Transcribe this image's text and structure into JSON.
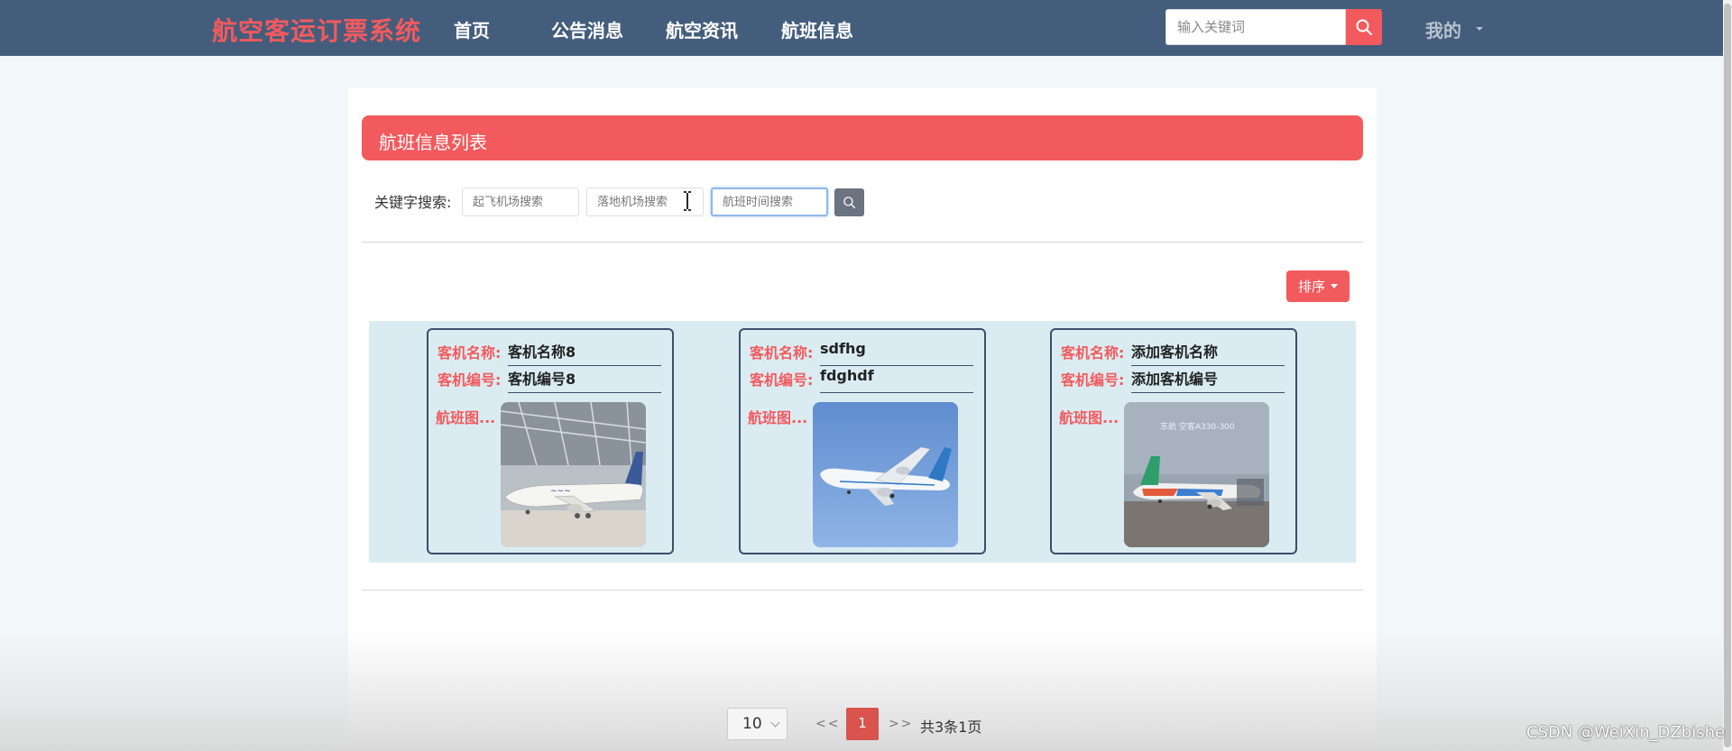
{
  "header": {
    "brand": "航空客运订票系统",
    "nav": [
      "首页",
      "公告消息",
      "航空资讯",
      "航班信息"
    ],
    "search_placeholder": "输入关键词",
    "user_menu": "我的"
  },
  "list": {
    "title": "航班信息列表",
    "keyword_label": "关键字搜索:",
    "filters": [
      "起飞机场搜索",
      "落地机场搜索",
      "航班时间搜索"
    ],
    "sort_label": "排序"
  },
  "labels": {
    "name": "客机名称:",
    "number": "客机编号:",
    "image": "航班图..."
  },
  "cards": [
    {
      "name": "客机名称8",
      "number": "客机编号8",
      "image_icon": "plane-hangar-photo"
    },
    {
      "name": "sdfhg",
      "number": "fdghdf",
      "image_icon": "plane-flying-photo"
    },
    {
      "name": "添加客机名称",
      "number": "添加客机编号",
      "image_icon": "plane-airport-photo"
    }
  ],
  "photo_caption": "东航 空客A330-300",
  "pagination": {
    "page_size": "10",
    "prev": "<<",
    "current": "1",
    "next": ">>",
    "total": "共3条1页"
  },
  "watermark": "CSDN @WeiXin_DZbishe",
  "colors": {
    "nav_bg": "#445d7d",
    "accent": "#f25a5d",
    "card_area": "#daecf2"
  }
}
